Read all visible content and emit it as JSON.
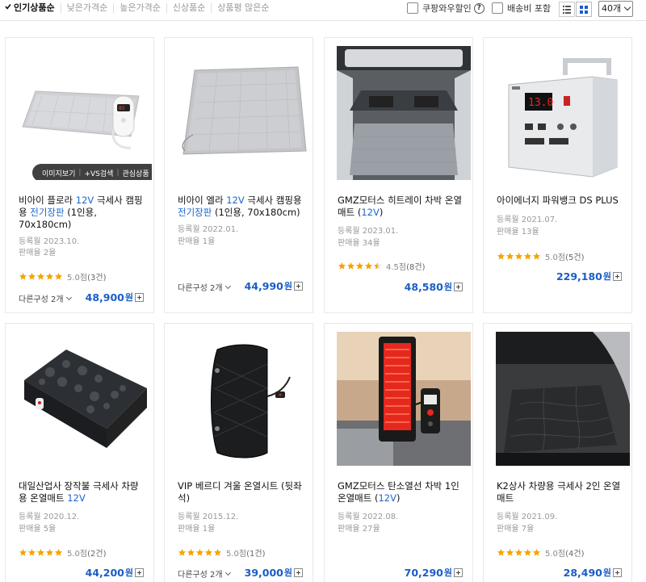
{
  "sort": {
    "tabs": [
      "인기상품순",
      "낮은가격순",
      "높은가격순",
      "신상품순",
      "상품평 많은순"
    ],
    "active_index": 0
  },
  "options": {
    "coupang_discount": "쿠팡와우할인",
    "help": "?",
    "shipping_included": "배송비 포함",
    "page_size": "40개"
  },
  "image_actions": [
    "이미지보기",
    "+VS검색",
    "관심상품"
  ],
  "products": [
    {
      "name_parts": [
        {
          "t": "비아이 플로라 "
        },
        {
          "t": "12V",
          "hl": true
        },
        {
          "t": " 극세사 캠핑용 "
        },
        {
          "t": "전기장판",
          "hl": true
        },
        {
          "t": " (1인용, 70x180cm)"
        }
      ],
      "reg": "등록월 2023.10.",
      "sales": "판매율 2율",
      "rating_score": "5.0점",
      "rating_count": "(3건)",
      "stars": 5,
      "options": "다른구성 2개",
      "price": "48,900",
      "won": "원"
    },
    {
      "name_parts": [
        {
          "t": "비아이 엘라 "
        },
        {
          "t": "12V",
          "hl": true
        },
        {
          "t": " 극세사 캠핑용 "
        },
        {
          "t": "전기장판",
          "hl": true
        },
        {
          "t": " (1인용, 70x180cm)"
        }
      ],
      "reg": "등록월 2022.01.",
      "sales": "판매율 1율",
      "rating_score": "",
      "rating_count": "",
      "stars": 0,
      "options": "다른구성 2개",
      "price": "44,990",
      "won": "원"
    },
    {
      "name_parts": [
        {
          "t": "GMZ모터스 히트레이 차박 온열매트 ("
        },
        {
          "t": "12V",
          "hl": true
        },
        {
          "t": ")"
        }
      ],
      "reg": "등록월 2023.01.",
      "sales": "판매율 34율",
      "rating_score": "4.5점",
      "rating_count": "(8건)",
      "stars": 4.5,
      "options": "",
      "price": "48,580",
      "won": "원"
    },
    {
      "name_parts": [
        {
          "t": "아이에너지 파워뱅크 DS PLUS"
        }
      ],
      "reg": "등록월 2021.07.",
      "sales": "판매율 13율",
      "rating_score": "5.0점",
      "rating_count": "(5건)",
      "stars": 5,
      "options": "",
      "price": "229,180",
      "won": "원"
    },
    {
      "name_parts": [
        {
          "t": "대일산업사 장작불 극세사 차량용 온열매트 "
        },
        {
          "t": "12V",
          "hl": true
        }
      ],
      "reg": "등록월 2020.12.",
      "sales": "판매율 5율",
      "rating_score": "5.0점",
      "rating_count": "(2건)",
      "stars": 5,
      "options": "",
      "price": "44,200",
      "won": "원"
    },
    {
      "name_parts": [
        {
          "t": "VIP 베르디 겨울 온열시트 (뒷좌석)"
        }
      ],
      "reg": "등록월 2015.12.",
      "sales": "판매율 1율",
      "rating_score": "5.0점",
      "rating_count": "(1건)",
      "stars": 5,
      "options": "다른구성 2개",
      "price": "39,000",
      "won": "원"
    },
    {
      "name_parts": [
        {
          "t": "GMZ모터스 탄소열선 차박 1인 온열매트 ("
        },
        {
          "t": "12V",
          "hl": true
        },
        {
          "t": ")"
        }
      ],
      "reg": "등록월 2022.08.",
      "sales": "판매율 27율",
      "rating_score": "",
      "rating_count": "",
      "stars": 0,
      "options": "",
      "price": "70,290",
      "won": "원"
    },
    {
      "name_parts": [
        {
          "t": "K2상사 차량용 극세사 2인 온열매트"
        }
      ],
      "reg": "등록월 2021.09.",
      "sales": "판매율 7율",
      "rating_score": "5.0점",
      "rating_count": "(4건)",
      "stars": 5,
      "options": "",
      "price": "28,490",
      "won": "원"
    }
  ],
  "colors": {
    "price": "#1a5dc8",
    "highlight": "#1a66d2",
    "star": "#f5a300"
  }
}
